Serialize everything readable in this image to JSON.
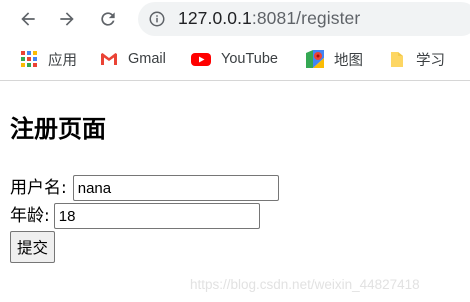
{
  "browser": {
    "url_host": "127.0.0.1",
    "url_rest": ":8081/register",
    "bookmarks": [
      {
        "label": "应用",
        "icon": "apps-grid-icon"
      },
      {
        "label": "Gmail",
        "icon": "gmail-icon"
      },
      {
        "label": "YouTube",
        "icon": "youtube-icon"
      },
      {
        "label": "地图",
        "icon": "maps-icon"
      },
      {
        "label": "学习",
        "icon": "folder-icon"
      }
    ]
  },
  "page": {
    "heading": "注册页面",
    "username_label": "用户名:",
    "username_value": "nana",
    "age_label": "年龄:",
    "age_value": "18",
    "submit_label": "提交",
    "watermark": "https://blog.csdn.net/weixin_44827418"
  },
  "colors": {
    "youtube_red": "#ff0000",
    "folder_yellow": "#fdd663",
    "chrome_gray": "#5f6368"
  }
}
